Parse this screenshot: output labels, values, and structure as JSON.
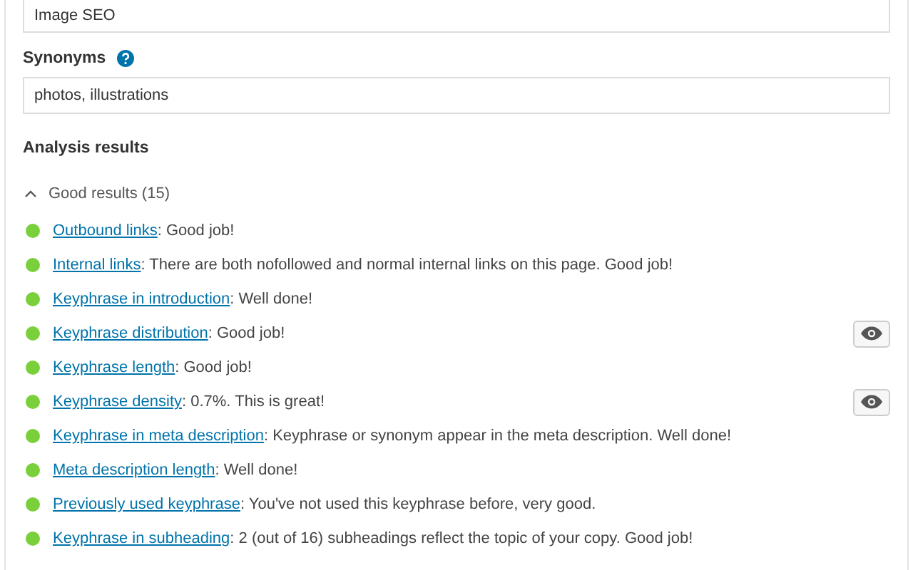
{
  "keyphrase_field": {
    "value": "Image SEO"
  },
  "synonyms": {
    "label": "Synonyms",
    "field": {
      "value": "photos, illustrations"
    }
  },
  "analysis": {
    "heading": "Analysis results",
    "group": {
      "label": "Good results (15)",
      "expanded": true,
      "results": [
        {
          "link": "Outbound links",
          "text": ": Good job!",
          "color": "#7ad03a",
          "marker_button": false
        },
        {
          "link": "Internal links",
          "text": ": There are both nofollowed and normal internal links on this page. Good job!",
          "color": "#7ad03a",
          "marker_button": false
        },
        {
          "link": "Keyphrase in introduction",
          "text": ": Well done!",
          "color": "#7ad03a",
          "marker_button": false
        },
        {
          "link": "Keyphrase distribution",
          "text": ": Good job!",
          "color": "#7ad03a",
          "marker_button": true
        },
        {
          "link": "Keyphrase length",
          "text": ": Good job!",
          "color": "#7ad03a",
          "marker_button": false
        },
        {
          "link": "Keyphrase density",
          "text": ": 0.7%. This is great!",
          "color": "#7ad03a",
          "marker_button": true
        },
        {
          "link": "Keyphrase in meta description",
          "text": ": Keyphrase or synonym appear in the meta description. Well done!",
          "color": "#7ad03a",
          "marker_button": false
        },
        {
          "link": "Meta description length",
          "text": ": Well done!",
          "color": "#7ad03a",
          "marker_button": false
        },
        {
          "link": "Previously used keyphrase",
          "text": ": You've not used this keyphrase before, very good.",
          "color": "#7ad03a",
          "marker_button": false
        },
        {
          "link": "Keyphrase in subheading",
          "text": ": 2 (out of 16) subheadings reflect the topic of your copy. Good job!",
          "color": "#7ad03a",
          "marker_button": false
        }
      ]
    }
  }
}
